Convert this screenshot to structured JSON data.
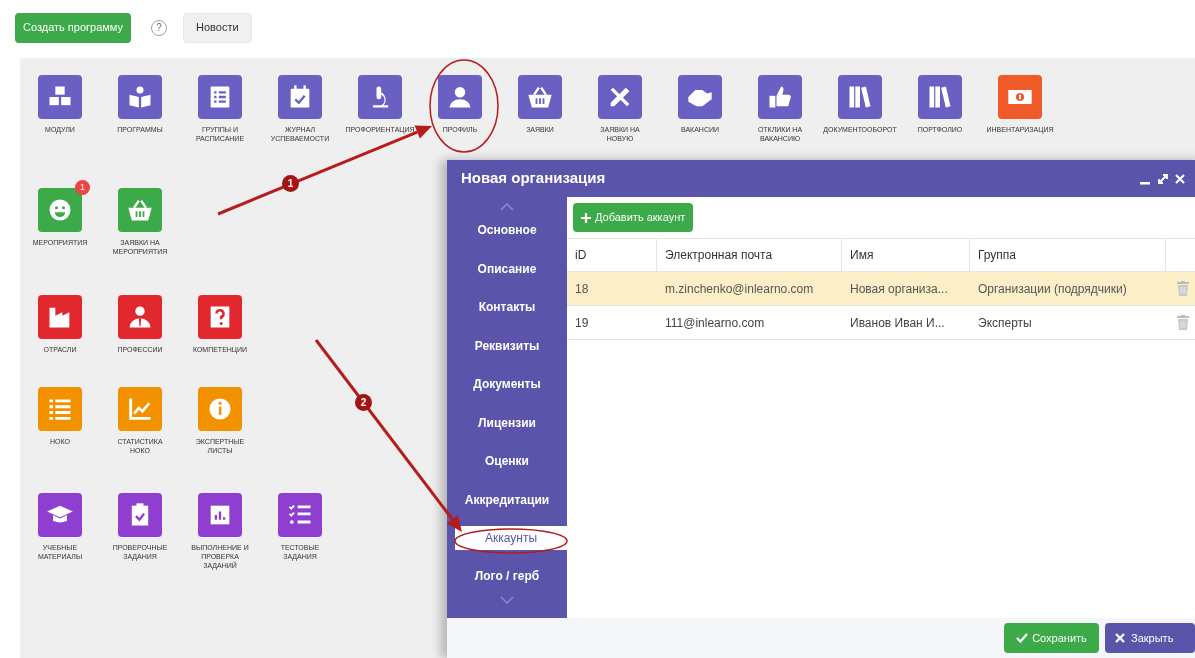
{
  "toolbar": {
    "create_button": "Создать программу",
    "help_icon": "?",
    "news_button": "Новости"
  },
  "tile_groups": [
    {
      "tiles": [
        {
          "label": "МОДУЛИ",
          "color": "#6a60c4"
        },
        {
          "label": "ПРОГРАММЫ",
          "color": "#6a60c4"
        },
        {
          "label": "ГРУППЫ И РАСПИСАНИЕ",
          "color": "#6a60c4"
        },
        {
          "label": "ЖУРНАЛ УСПЕВАЕМОСТИ",
          "color": "#6a60c4"
        },
        {
          "label": "ПРОФОРИЕНТАЦИЯ",
          "color": "#6a60c4"
        },
        {
          "label": "ПРОФИЛЬ",
          "color": "#6a60c4"
        },
        {
          "label": "ЗАЯВКИ",
          "color": "#6a60c4"
        },
        {
          "label": "ЗАЯВКИ НА НОВУЮ",
          "color": "#6a60c4"
        },
        {
          "label": "ВАКАНСИИ",
          "color": "#6a60c4"
        },
        {
          "label": "ОТКЛИКИ НА ВАКАНСИЮ",
          "color": "#6a60c4"
        },
        {
          "label": "ДОКУМЕНТООБОРОТ",
          "color": "#6a60c4"
        },
        {
          "label": "ПОРТФОЛИО",
          "color": "#6a60c4"
        },
        {
          "label": "ИНВЕНТАРИЗАЦИЯ",
          "color": "#f05a28"
        }
      ]
    },
    {
      "tiles": [
        {
          "label": "МЕРОПРИЯТИЯ",
          "color": "#3daa4a",
          "badge": "1"
        },
        {
          "label": "ЗАЯВКИ НА МЕРОПРИЯТИЯ",
          "color": "#3daa4a"
        }
      ]
    },
    {
      "tiles": [
        {
          "label": "ОТРАСЛИ",
          "color": "#e0282e"
        },
        {
          "label": "ПРОФЕССИИ",
          "color": "#e0282e"
        },
        {
          "label": "КОМПЕТЕНЦИИ",
          "color": "#e0282e"
        }
      ]
    },
    {
      "tiles": [
        {
          "label": "НОКО",
          "color": "#f39200"
        },
        {
          "label": "СТАТИСТИКА НОКО",
          "color": "#f39200"
        },
        {
          "label": "ЭКСПЕРТНЫЕ ЛИСТЫ",
          "color": "#f39200"
        }
      ]
    },
    {
      "tiles": [
        {
          "label": "УЧЕБНЫЕ МАТЕРИАЛЫ",
          "color": "#8e3fd0"
        },
        {
          "label": "ПРОВЕРОЧНЫЕ ЗАДАНИЯ",
          "color": "#8e3fd0"
        },
        {
          "label": "ВЫПОЛНЕНИЕ И ПРОВЕРКА ЗАДАНИЙ",
          "color": "#8e3fd0"
        },
        {
          "label": "ТЕСТОВЫЕ ЗАДАНИЯ",
          "color": "#8e3fd0"
        }
      ]
    }
  ],
  "dialog": {
    "title": "Новая организация",
    "sidebar": {
      "items": [
        {
          "label": "Основное",
          "selected": false
        },
        {
          "label": "Описание",
          "selected": false
        },
        {
          "label": "Контакты",
          "selected": false
        },
        {
          "label": "Реквизиты",
          "selected": false
        },
        {
          "label": "Документы",
          "selected": false
        },
        {
          "label": "Лицензии",
          "selected": false
        },
        {
          "label": "Оценки",
          "selected": false
        },
        {
          "label": "Аккредитации",
          "selected": false
        },
        {
          "label": "Аккаунты",
          "selected": true
        },
        {
          "label": "Лого / герб",
          "selected": false
        }
      ]
    },
    "add_button": "Добавить аккаунт",
    "table": {
      "columns": [
        "iD",
        "Электронная почта",
        "Имя",
        "Группа"
      ],
      "rows": [
        {
          "cells": [
            "18",
            "m.zinchenko@inlearno.com",
            "Новая организа...",
            "Организации (подрядчики)"
          ],
          "selected": true
        },
        {
          "cells": [
            "19",
            "111@inlearno.com",
            "Иванов Иван И...",
            "Эксперты"
          ],
          "selected": false
        }
      ]
    },
    "footer": {
      "save_button": "Сохранить",
      "close_button": "Закрыть"
    }
  },
  "annotations": [
    {
      "kind": "arrow",
      "badge": "1"
    },
    {
      "kind": "arrow",
      "badge": "2"
    },
    {
      "kind": "ellipse"
    },
    {
      "kind": "ellipse"
    }
  ]
}
